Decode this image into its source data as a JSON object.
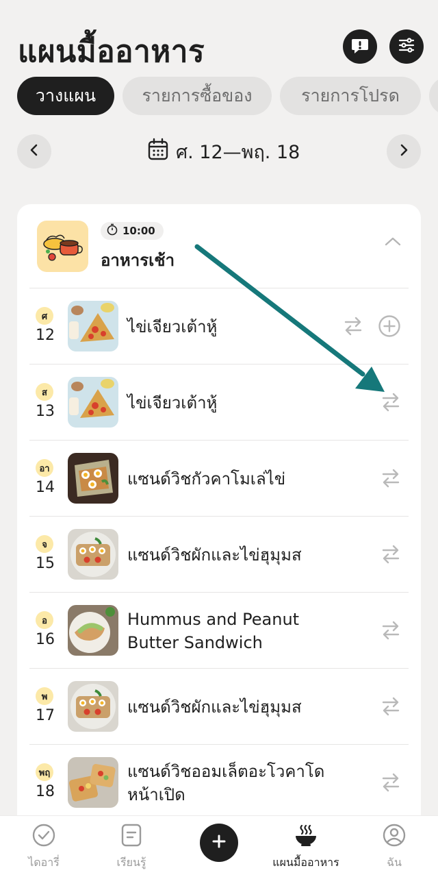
{
  "header": {
    "title": "แผนมื้ออาหาร",
    "feedback_icon": "feedback-icon",
    "filter_icon": "sliders-icon"
  },
  "tabs": [
    {
      "label": "วางแผน",
      "active": true
    },
    {
      "label": "รายการซื้อของ",
      "active": false
    },
    {
      "label": "รายการโปรด",
      "active": false
    }
  ],
  "date_nav": {
    "range": "ศ. 12—พฤ. 18",
    "prev_icon": "chevron-left-icon",
    "next_icon": "chevron-right-icon",
    "calendar_icon": "calendar-icon"
  },
  "meal": {
    "time": "10:00",
    "title": "อาหารเช้า",
    "collapse_icon": "chevron-up-icon"
  },
  "rows": [
    {
      "day": "ศ",
      "date": "12",
      "name": "ไข่เจียวเต้าหู้"
    },
    {
      "day": "ส",
      "date": "13",
      "name": "ไข่เจียวเต้าหู้"
    },
    {
      "day": "อา",
      "date": "14",
      "name": "แซนด์วิชกัวคาโมเล่ไข่"
    },
    {
      "day": "จ",
      "date": "15",
      "name": "แซนด์วิชผักและไข่ฮุมุมส"
    },
    {
      "day": "อ",
      "date": "16",
      "name": "Hummus and Peanut Butter Sandwich"
    },
    {
      "day": "พ",
      "date": "17",
      "name": "แซนด์วิชผักและไข่ฮุมุมส"
    },
    {
      "day": "พฤ",
      "date": "18",
      "name": "แซนด์วิชออมเล็ตอะโวคาโดหน้าเปิด"
    }
  ],
  "bottom_nav": [
    {
      "label": "ไดอารี่",
      "icon": "check-circle-icon",
      "active": false
    },
    {
      "label": "เรียนรู้",
      "icon": "book-icon",
      "active": false
    },
    {
      "label": "",
      "icon": "plus-icon",
      "active": false
    },
    {
      "label": "แผนมื้ออาหาร",
      "icon": "bowl-icon",
      "active": true
    },
    {
      "label": "ฉัน",
      "icon": "profile-icon",
      "active": false
    }
  ],
  "colors": {
    "accent_dark": "#1f1f1f",
    "background": "#f2f1f0",
    "day_badge": "#fce9a8",
    "annotation_arrow": "#16787a"
  }
}
